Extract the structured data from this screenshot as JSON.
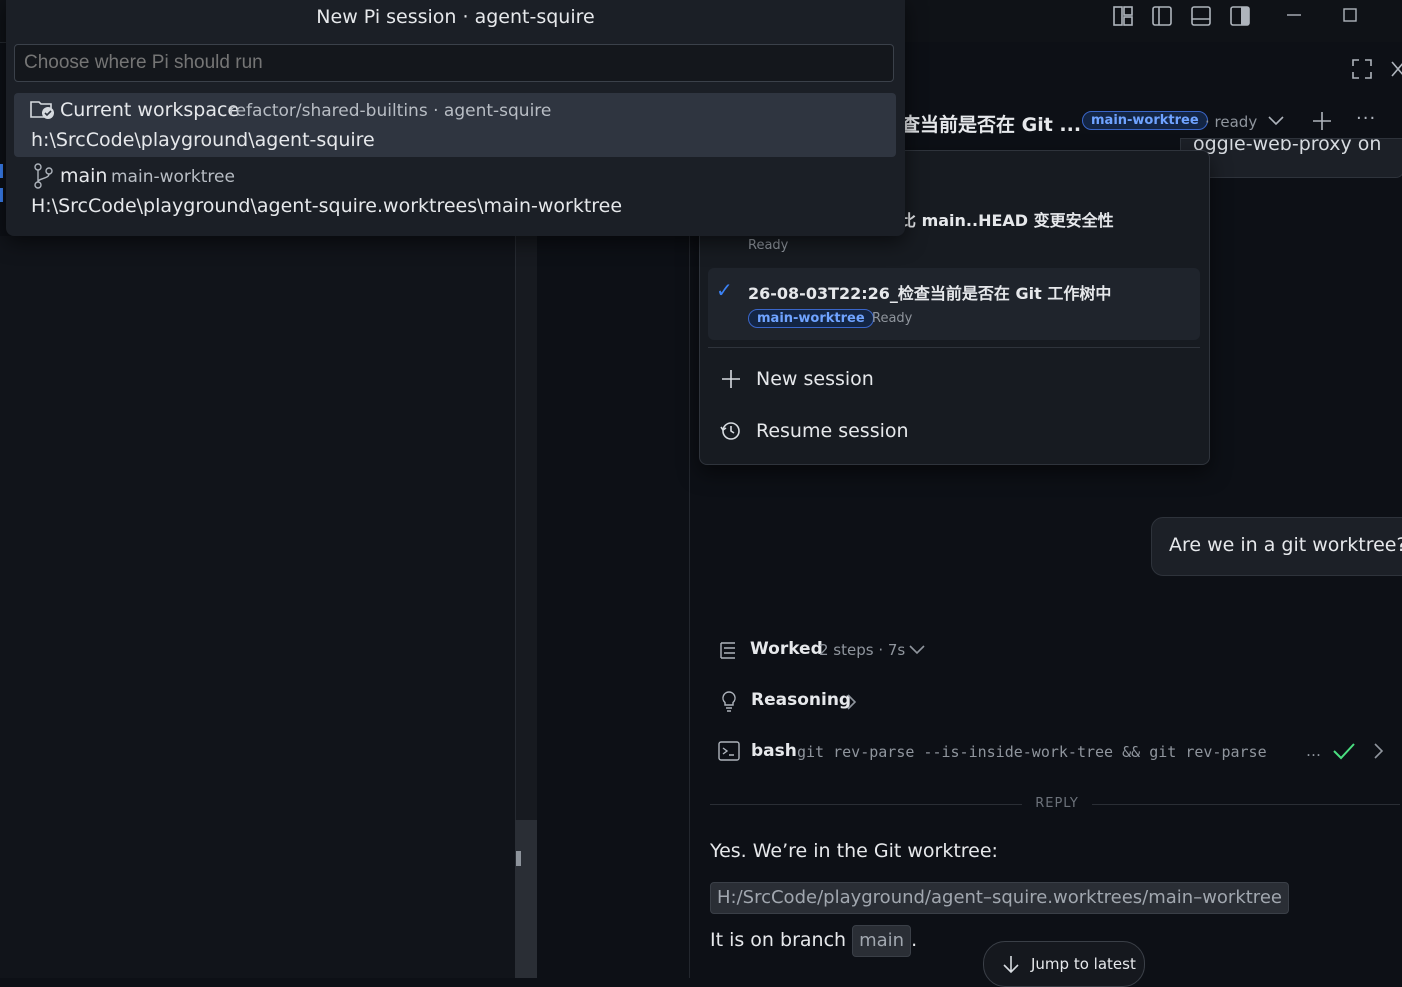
{
  "quick_pick": {
    "title": "New Pi session · agent-squire",
    "placeholder": "Choose where Pi should run",
    "items": [
      {
        "label": "Current workspace",
        "detail": "refactor/shared-builtins · agent-squire",
        "path": "h:\\SrcCode\\playground\\agent-squire",
        "icon": "folder-check-icon"
      },
      {
        "label": "main",
        "detail": "main-worktree",
        "path": "H:\\SrcCode\\playground\\agent-squire.worktrees\\main-worktree",
        "icon": "git-branch-icon"
      }
    ]
  },
  "session_header": {
    "title": "查当前是否在 Git ...",
    "badge": "main-worktree",
    "status": "· ready",
    "peek_text": "oggle-web-proxy on"
  },
  "session_dropdown": {
    "partial_title": "比 main..HEAD 变更安全性",
    "partial_status": "Ready",
    "selected": {
      "title": "26-08-03T22:26_检查当前是否在 Git 工作树中",
      "badge": "main-worktree",
      "status": "Ready"
    },
    "actions": [
      {
        "label": "New session",
        "icon": "plus-icon"
      },
      {
        "label": "Resume session",
        "icon": "history-icon"
      }
    ]
  },
  "chat": {
    "user_message": "Are we in a git worktree?",
    "worked_label": "Worked",
    "worked_meta": "2 steps · 7s",
    "reasoning_label": "Reasoning",
    "tool_name": "bash",
    "tool_command": "git rev-parse --is-inside-work-tree && git rev-parse",
    "tool_ellipsis": "…",
    "reply_divider": "REPLY",
    "reply_line1": "Yes. We’re in the Git worktree:",
    "reply_path": "H:/SrcCode/playground/agent–squire.worktrees/main–worktree",
    "reply_line2_prefix": "It is on branch",
    "reply_branch": "main",
    "reply_line2_suffix": ".",
    "jump_label": "Jump to latest"
  },
  "colors": {
    "accent": "#3b82f6",
    "success": "#4ade80",
    "background": "#0d1016",
    "panel": "#1b1f26"
  }
}
